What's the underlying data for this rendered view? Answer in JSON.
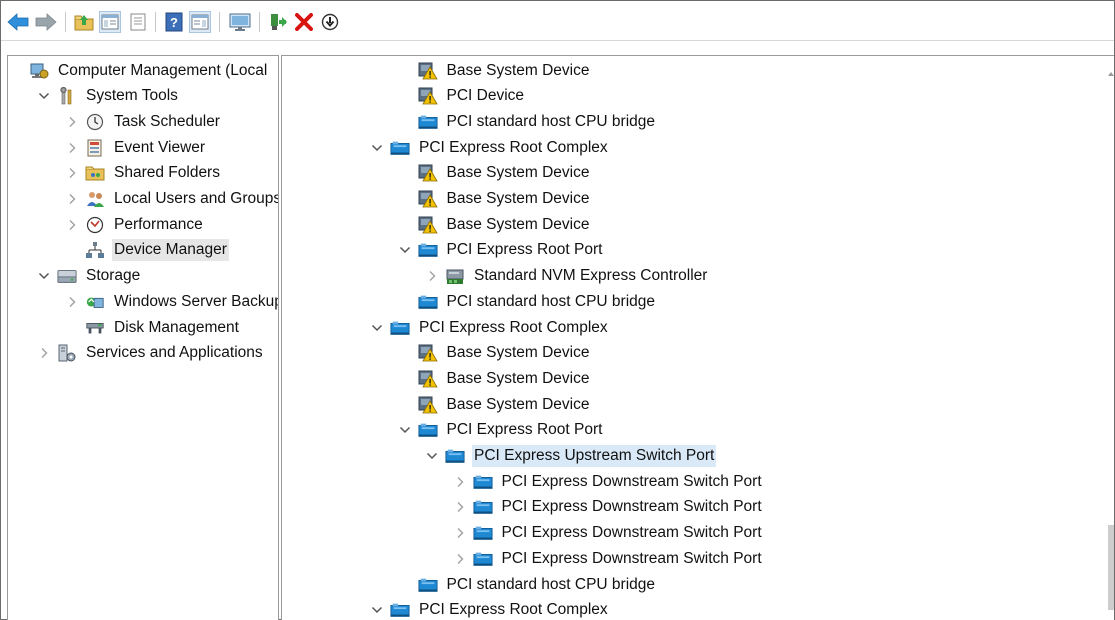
{
  "toolbar": {
    "buttons": [
      {
        "name": "back-button",
        "icon": "back-arrow-icon"
      },
      {
        "name": "forward-button",
        "icon": "forward-arrow-icon"
      },
      {
        "name": "up-level-button",
        "icon": "folder-up-icon"
      },
      {
        "name": "show-hide-tree-button",
        "icon": "console-tree-icon"
      },
      {
        "name": "properties-button",
        "icon": "properties-icon"
      },
      {
        "name": "help-button",
        "icon": "help-icon"
      },
      {
        "name": "show-hide-action-pane-button",
        "icon": "action-pane-icon"
      },
      {
        "name": "scan-hardware-button",
        "icon": "monitor-scan-icon"
      },
      {
        "name": "update-driver-button",
        "icon": "update-driver-icon"
      },
      {
        "name": "uninstall-device-button",
        "icon": "red-x-icon"
      },
      {
        "name": "disable-device-button",
        "icon": "down-circle-icon"
      }
    ]
  },
  "left_tree": [
    {
      "label": "Computer Management (Local",
      "icon": "computer-management-icon",
      "chevron": "none",
      "level": 0
    },
    {
      "label": "System Tools",
      "icon": "tools-icon",
      "chevron": "expanded",
      "level": 1
    },
    {
      "label": "Task Scheduler",
      "icon": "clock-icon",
      "chevron": "collapsed",
      "level": 2
    },
    {
      "label": "Event Viewer",
      "icon": "event-viewer-icon",
      "chevron": "collapsed",
      "level": 2
    },
    {
      "label": "Shared Folders",
      "icon": "shared-folder-icon",
      "chevron": "collapsed",
      "level": 2
    },
    {
      "label": "Local Users and Groups",
      "icon": "users-icon",
      "chevron": "collapsed",
      "level": 2
    },
    {
      "label": "Performance",
      "icon": "performance-icon",
      "chevron": "collapsed",
      "level": 2
    },
    {
      "label": "Device Manager",
      "icon": "device-manager-icon",
      "chevron": "none",
      "level": 2,
      "selected": true
    },
    {
      "label": "Storage",
      "icon": "storage-icon",
      "chevron": "expanded",
      "level": 1
    },
    {
      "label": "Windows Server Backup",
      "icon": "backup-icon",
      "chevron": "collapsed",
      "level": 2
    },
    {
      "label": "Disk Management",
      "icon": "disk-icon",
      "chevron": "none",
      "level": 2
    },
    {
      "label": "Services and Applications",
      "icon": "services-icon",
      "chevron": "collapsed",
      "level": 1
    }
  ],
  "device_tree": [
    {
      "label": "Base System Device",
      "icon": "warning-device-icon",
      "chevron": "none",
      "level": 1
    },
    {
      "label": "PCI Device",
      "icon": "warning-device-icon",
      "chevron": "none",
      "level": 1
    },
    {
      "label": "PCI standard host CPU bridge",
      "icon": "pci-device-icon",
      "chevron": "none",
      "level": 1
    },
    {
      "label": "PCI Express Root Complex",
      "icon": "pci-device-icon",
      "chevron": "expanded",
      "level": 0
    },
    {
      "label": "Base System Device",
      "icon": "warning-device-icon",
      "chevron": "none",
      "level": 1
    },
    {
      "label": "Base System Device",
      "icon": "warning-device-icon",
      "chevron": "none",
      "level": 1
    },
    {
      "label": "Base System Device",
      "icon": "warning-device-icon",
      "chevron": "none",
      "level": 1
    },
    {
      "label": "PCI Express Root Port",
      "icon": "pci-device-icon",
      "chevron": "expanded",
      "level": 1
    },
    {
      "label": "Standard NVM Express Controller",
      "icon": "storage-controller-icon",
      "chevron": "collapsed",
      "level": 2
    },
    {
      "label": "PCI standard host CPU bridge",
      "icon": "pci-device-icon",
      "chevron": "none",
      "level": 1
    },
    {
      "label": "PCI Express Root Complex",
      "icon": "pci-device-icon",
      "chevron": "expanded",
      "level": 0
    },
    {
      "label": "Base System Device",
      "icon": "warning-device-icon",
      "chevron": "none",
      "level": 1
    },
    {
      "label": "Base System Device",
      "icon": "warning-device-icon",
      "chevron": "none",
      "level": 1
    },
    {
      "label": "Base System Device",
      "icon": "warning-device-icon",
      "chevron": "none",
      "level": 1
    },
    {
      "label": "PCI Express Root Port",
      "icon": "pci-device-icon",
      "chevron": "expanded",
      "level": 1
    },
    {
      "label": "PCI Express Upstream Switch Port",
      "icon": "pci-device-icon",
      "chevron": "expanded",
      "level": 2,
      "selected": true
    },
    {
      "label": "PCI Express Downstream Switch Port",
      "icon": "pci-device-icon",
      "chevron": "collapsed",
      "level": 3
    },
    {
      "label": "PCI Express Downstream Switch Port",
      "icon": "pci-device-icon",
      "chevron": "collapsed",
      "level": 3
    },
    {
      "label": "PCI Express Downstream Switch Port",
      "icon": "pci-device-icon",
      "chevron": "collapsed",
      "level": 3
    },
    {
      "label": "PCI Express Downstream Switch Port",
      "icon": "pci-device-icon",
      "chevron": "collapsed",
      "level": 3
    },
    {
      "label": "PCI standard host CPU bridge",
      "icon": "pci-device-icon",
      "chevron": "none",
      "level": 1
    },
    {
      "label": "PCI Express Root Complex",
      "icon": "pci-device-icon",
      "chevron": "expanded",
      "level": 0
    }
  ],
  "colors": {
    "selection_gray": "#e6e6e6",
    "selection_blue": "#d9e9f8",
    "chevron": "#6d6d6d",
    "pci_blue": "#1e88d3",
    "warning_yellow": "#f2c200",
    "red_x": "#d7140f"
  }
}
